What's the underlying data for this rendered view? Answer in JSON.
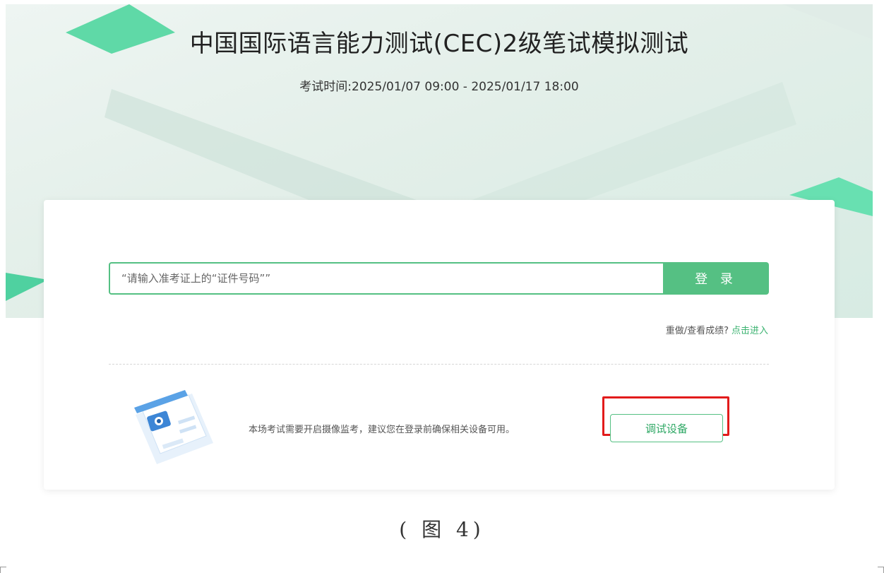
{
  "hero": {
    "title": "中国国际语言能力测试(CEC)2级笔试模拟测试",
    "time": "考试时间:2025/01/07 09:00 - 2025/01/17 18:00"
  },
  "login": {
    "placeholder": "“请输入准考证上的“证件号码””",
    "button_label": "登 录"
  },
  "redo": {
    "text": "重做/查看成绩?",
    "link": "点击进入"
  },
  "device": {
    "notice": "本场考试需要开启摄像监考，建议您在登录前确保相关设备可用。",
    "button_label": "调试设备"
  },
  "caption": "( 图 4)",
  "colors": {
    "accent": "#55c083",
    "highlight": "#e21b1b"
  }
}
